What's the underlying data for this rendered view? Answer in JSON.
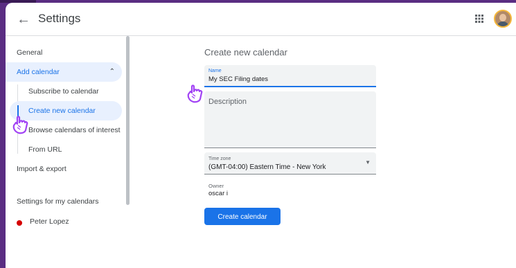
{
  "header": {
    "title": "Settings"
  },
  "sidebar": {
    "items": [
      {
        "label": "General"
      },
      {
        "label": "Add calendar"
      },
      {
        "label": "Subscribe to calendar"
      },
      {
        "label": "Create new calendar"
      },
      {
        "label": "Browse calendars of interest"
      },
      {
        "label": "From URL"
      },
      {
        "label": "Import & export"
      },
      {
        "label": "Settings for my calendars"
      },
      {
        "label": "Peter Lopez"
      }
    ]
  },
  "main": {
    "heading": "Create new calendar",
    "name_label": "Name",
    "name_value": "My SEC Filing dates",
    "description_label": "Description",
    "timezone_label": "Time zone",
    "timezone_value": "(GMT-04:00) Eastern Time - New York",
    "owner_label": "Owner",
    "owner_value": "oscar i",
    "create_button": "Create calendar"
  },
  "colors": {
    "accent": "#1a73e8",
    "frame": "#5a2d82",
    "calendar_dot": "#d50000",
    "pointer": "#a142f4"
  }
}
